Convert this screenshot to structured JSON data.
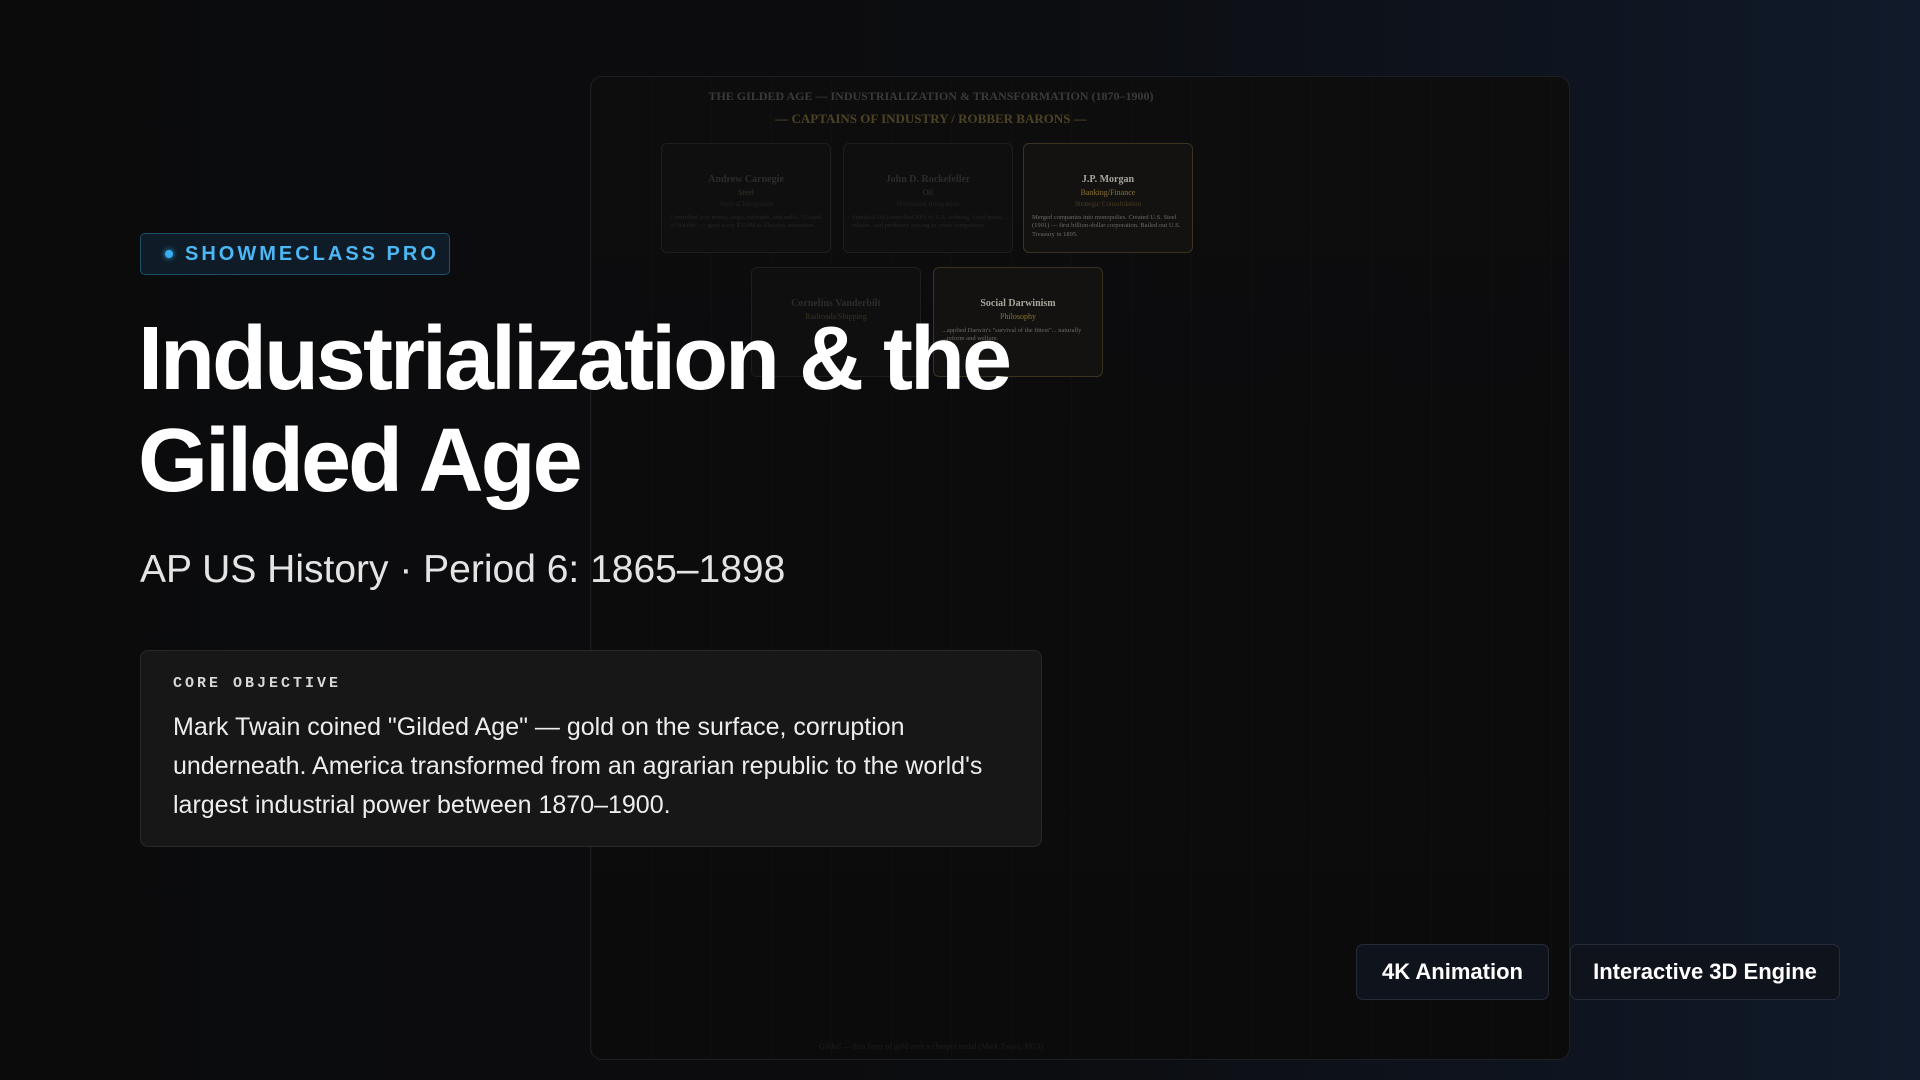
{
  "background_slide": {
    "title": "THE GILDED AGE — INDUSTRIALIZATION & TRANSFORMATION (1870–1900)",
    "subtitle": "— CAPTAINS OF INDUSTRY / ROBBER BARONS —",
    "cards": [
      {
        "name": "Andrew Carnegie",
        "industry": "Steel",
        "strategy": "Vertical Integration",
        "desc": "Controlled iron mines, ships, railroads, and mills. \"Gospel of Wealth\" — gave away $350M to libraries, education."
      },
      {
        "name": "John D. Rockefeller",
        "industry": "Oil",
        "strategy": "Horizontal Integration",
        "desc": "Standard Oil controlled 90% of U.S. refining. Used trusts, rebates, and predatory pricing to crush competitors."
      },
      {
        "name": "J.P. Morgan",
        "industry": "Banking/Finance",
        "strategy": "Strategic Consolidation",
        "desc": "Merged companies into monopolies. Created U.S. Steel (1901) — first billion-dollar corporation. Bailed out U.S. Treasury in 1895."
      },
      {
        "name": "Cornelius Vanderbilt",
        "industry": "Railroads/Shipping",
        "strategy": "",
        "desc": ""
      },
      {
        "name": "Social Darwinism",
        "industry": "Philosophy",
        "strategy": "",
        "desc": "...applied Darwin's \"survival of the fittest\"... naturally ...reform and welfare."
      }
    ],
    "footer": "Gilded — thin layer of gold over a cheaper metal (Mark Twain, 1873)"
  },
  "badge": {
    "label": "SHOWMECLASS PRO"
  },
  "title": {
    "line1": "Industrialization & the",
    "line2": "Gilded Age"
  },
  "subtitle": "AP US History · Period 6: 1865–1898",
  "objective": {
    "label": "CORE OBJECTIVE",
    "text": "Mark Twain coined \"Gilded Age\" — gold on the surface, corruption underneath. America transformed from an agrarian republic to the world's largest industrial power between 1870–1900."
  },
  "buttons": {
    "animation": "4K Animation",
    "engine": "Interactive 3D Engine"
  },
  "colors": {
    "accent": "#37aef0",
    "background": "#0b0b0c",
    "gold": "#8a7230"
  }
}
